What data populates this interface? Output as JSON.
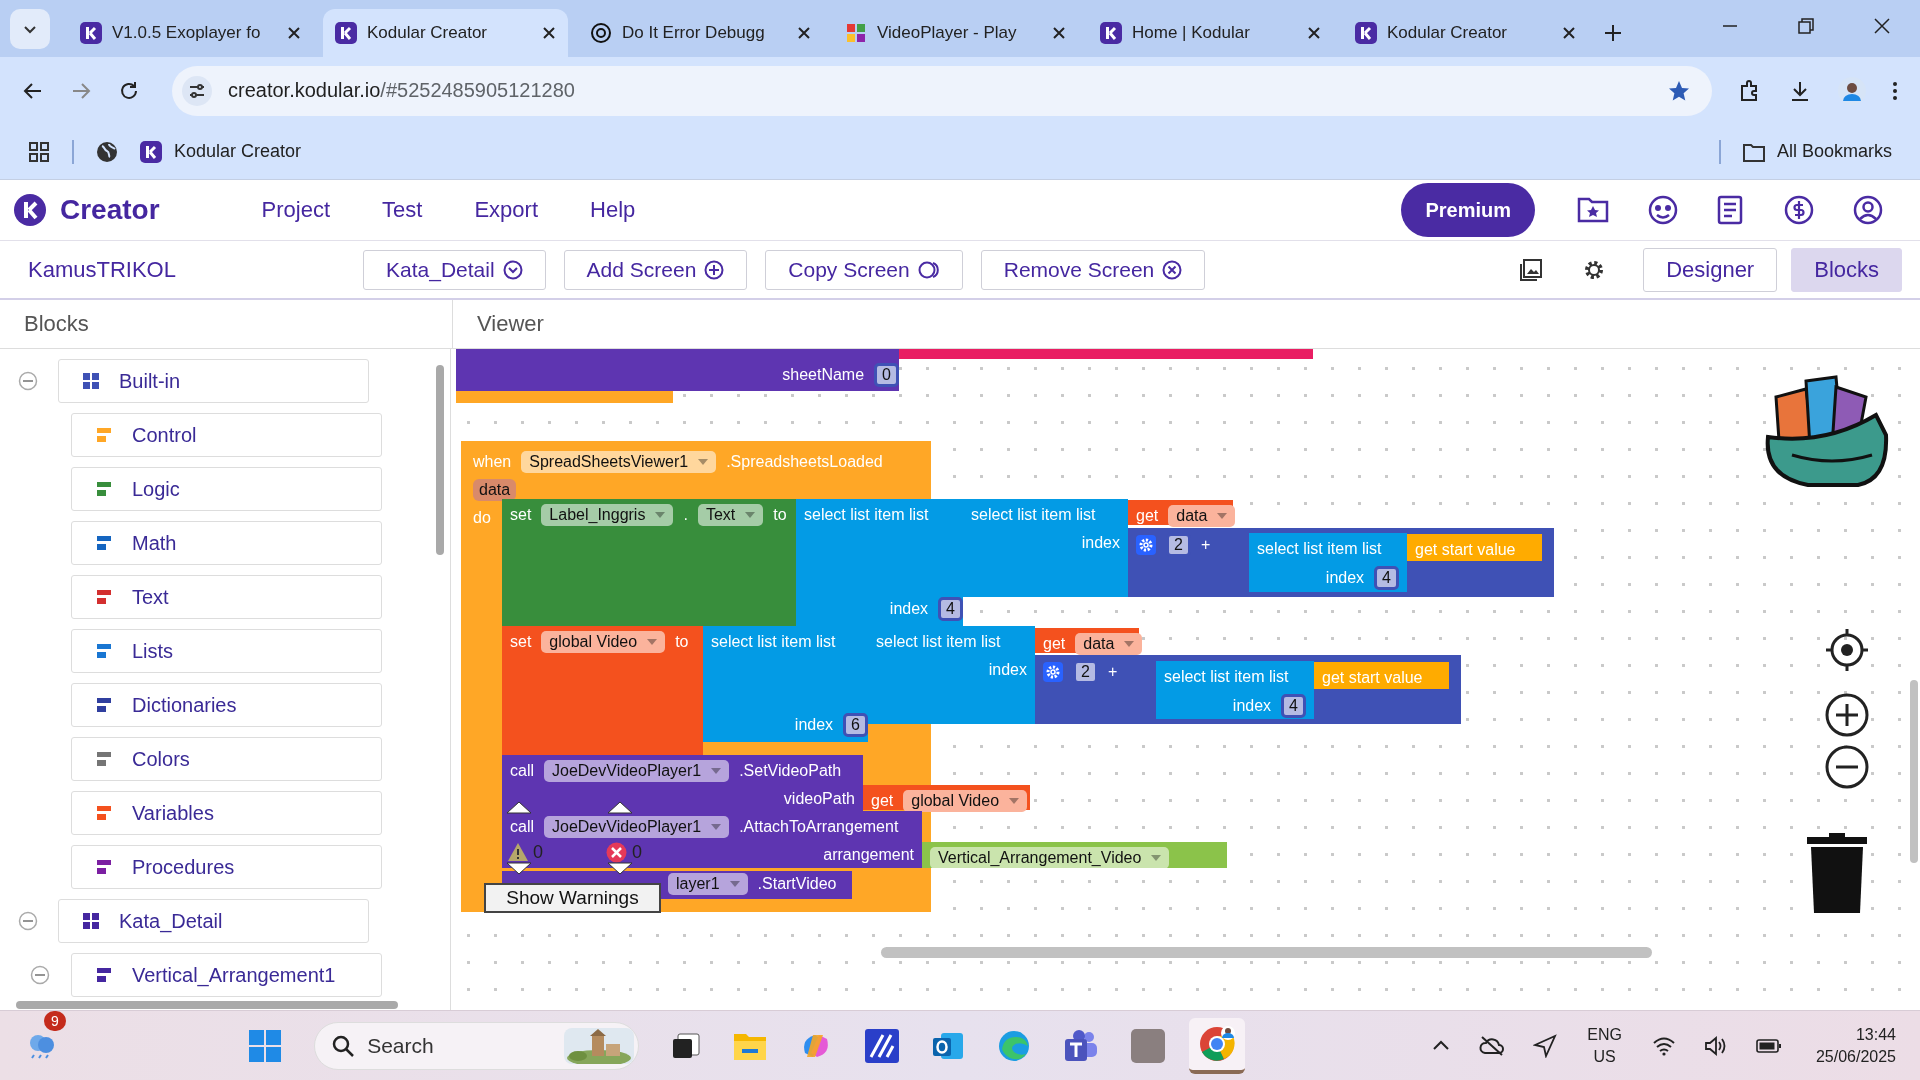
{
  "browser": {
    "tabs": [
      {
        "title": "V1.0.5 Exoplayer fo",
        "selected": false
      },
      {
        "title": "Kodular Creator",
        "selected": true
      },
      {
        "title": "Do It Error Debugg",
        "selected": false
      },
      {
        "title": "VideoPlayer - Play",
        "selected": false
      },
      {
        "title": "Home | Kodular",
        "selected": false
      },
      {
        "title": "Kodular Creator",
        "selected": false
      }
    ],
    "address": {
      "host": "creator.kodular.io",
      "path": "/#5252485905121280"
    },
    "bookmarks": [
      {
        "label": "Kodular Creator"
      }
    ],
    "all_bookmarks": "All Bookmarks"
  },
  "app": {
    "brand": "Creator",
    "menu": [
      "Project",
      "Test",
      "Export",
      "Help"
    ],
    "premium": "Premium",
    "project": "KamusTRIKOL",
    "screen_buttons": [
      "Kata_Detail",
      "Add Screen",
      "Copy Screen",
      "Remove Screen"
    ],
    "views": [
      {
        "label": "Designer",
        "selected": false
      },
      {
        "label": "Blocks",
        "selected": true
      }
    ]
  },
  "panels": {
    "blocks_title": "Blocks",
    "viewer_title": "Viewer"
  },
  "tree": [
    {
      "label": "Built-in",
      "expanded": true,
      "children": [
        {
          "label": "Control"
        },
        {
          "label": "Logic"
        },
        {
          "label": "Math"
        },
        {
          "label": "Text"
        },
        {
          "label": "Lists"
        },
        {
          "label": "Dictionaries"
        },
        {
          "label": "Colors"
        },
        {
          "label": "Variables"
        },
        {
          "label": "Procedures"
        }
      ]
    },
    {
      "label": "Kata_Detail",
      "expanded": true,
      "children": [
        {
          "label": "Vertical_Arrangement1",
          "expanded": true
        }
      ]
    }
  ],
  "canvas": {
    "blocks": [
      {
        "kind": "text"
      },
      {
        "kind": "component",
        "sockets": [
          {
            "label": "sheetName",
            "value": "0"
          }
        ]
      },
      {
        "kind": "event"
      },
      {
        "kind": "event",
        "items": [
          {
            "kind": "text",
            "text": "when"
          },
          {
            "kind": "dropdown",
            "text": "SpreadSheetsViewer1"
          },
          {
            "kind": "text",
            "text": ".SpreadsheetsLoaded"
          }
        ],
        "params": [
          "data"
        ],
        "sockets": [
          {
            "label": "do"
          }
        ]
      },
      {
        "kind": "setter",
        "items": [
          {
            "kind": "text",
            "text": "set"
          },
          {
            "kind": "dropdown",
            "text": "Label_Inggris"
          },
          {
            "kind": "text",
            "text": "."
          },
          {
            "kind": "dropdown",
            "text": "Text"
          },
          {
            "kind": "text",
            "text": "to"
          }
        ]
      },
      {
        "kind": "list",
        "items": [
          {
            "kind": "text",
            "text": "select list item  list"
          }
        ],
        "sockets": [
          {
            "label": "index",
            "value": "4"
          }
        ]
      },
      {
        "kind": "list",
        "items": [
          {
            "kind": "text",
            "text": "select list item  list"
          }
        ],
        "sockets": [
          {
            "label": "index"
          }
        ]
      },
      {
        "kind": "variable",
        "items": [
          {
            "kind": "text",
            "text": "get"
          },
          {
            "kind": "dropdown",
            "text": "data"
          }
        ]
      },
      {
        "kind": "math",
        "items": [
          {
            "kind": "gear"
          },
          {
            "kind": "number",
            "text": "2"
          },
          {
            "kind": "text",
            "text": "+"
          }
        ]
      },
      {
        "kind": "list",
        "items": [
          {
            "kind": "text",
            "text": "select list item  list"
          }
        ],
        "sockets": [
          {
            "label": "index",
            "value": "4"
          }
        ]
      },
      {
        "kind": "value",
        "items": [
          {
            "kind": "text",
            "text": "get start value"
          }
        ]
      },
      {
        "kind": "variable",
        "items": [
          {
            "kind": "text",
            "text": "set"
          },
          {
            "kind": "dropdown",
            "text": "global Video"
          },
          {
            "kind": "text",
            "text": "to"
          }
        ]
      },
      {
        "kind": "list",
        "items": [
          {
            "kind": "text",
            "text": "select list item  list"
          }
        ],
        "sockets": [
          {
            "label": "index",
            "value": "6"
          }
        ]
      },
      {
        "kind": "list",
        "items": [
          {
            "kind": "text",
            "text": "select list item  list"
          }
        ],
        "sockets": [
          {
            "label": "index"
          }
        ]
      },
      {
        "kind": "variable",
        "items": [
          {
            "kind": "text",
            "text": "get"
          },
          {
            "kind": "dropdown",
            "text": "data"
          }
        ]
      },
      {
        "kind": "math",
        "items": [
          {
            "kind": "gear"
          },
          {
            "kind": "number",
            "text": "2"
          },
          {
            "kind": "text",
            "text": "+"
          }
        ]
      },
      {
        "kind": "list",
        "items": [
          {
            "kind": "text",
            "text": "select list item  list"
          }
        ],
        "sockets": [
          {
            "label": "index",
            "value": "4"
          }
        ]
      },
      {
        "kind": "value",
        "items": [
          {
            "kind": "text",
            "text": "get start value"
          }
        ]
      },
      {
        "kind": "component",
        "items": [
          {
            "kind": "text",
            "text": "call"
          },
          {
            "kind": "dropdown",
            "text": "JoeDevVideoPlayer1"
          },
          {
            "kind": "text",
            "text": ".SetVideoPath"
          }
        ],
        "sockets": [
          {
            "label": "videoPath"
          }
        ]
      },
      {
        "kind": "variable",
        "items": [
          {
            "kind": "text",
            "text": "get"
          },
          {
            "kind": "dropdown",
            "text": "global Video"
          }
        ]
      },
      {
        "kind": "component",
        "items": [
          {
            "kind": "text",
            "text": "call"
          },
          {
            "kind": "dropdown",
            "text": "JoeDevVideoPlayer1"
          },
          {
            "kind": "text",
            "text": ".AttachToArrangement"
          }
        ],
        "sockets": [
          {
            "label": "arrangement"
          }
        ]
      },
      {
        "kind": "arrangement",
        "items": [
          {
            "kind": "dropdown",
            "text": "Vertical_Arrangement_Video"
          }
        ]
      },
      {
        "kind": "component",
        "items": [
          {
            "kind": "dropdown",
            "text": "layer1"
          },
          {
            "kind": "text",
            "text": ".StartVideo"
          }
        ]
      }
    ],
    "warnings": {
      "warning_count": "0",
      "error_count": "0",
      "button": "Show Warnings"
    }
  },
  "taskbar": {
    "badge": "9",
    "search_placeholder": "Search",
    "language": "ENG",
    "region": "US",
    "time": "13:44",
    "date": "25/06/2025"
  }
}
